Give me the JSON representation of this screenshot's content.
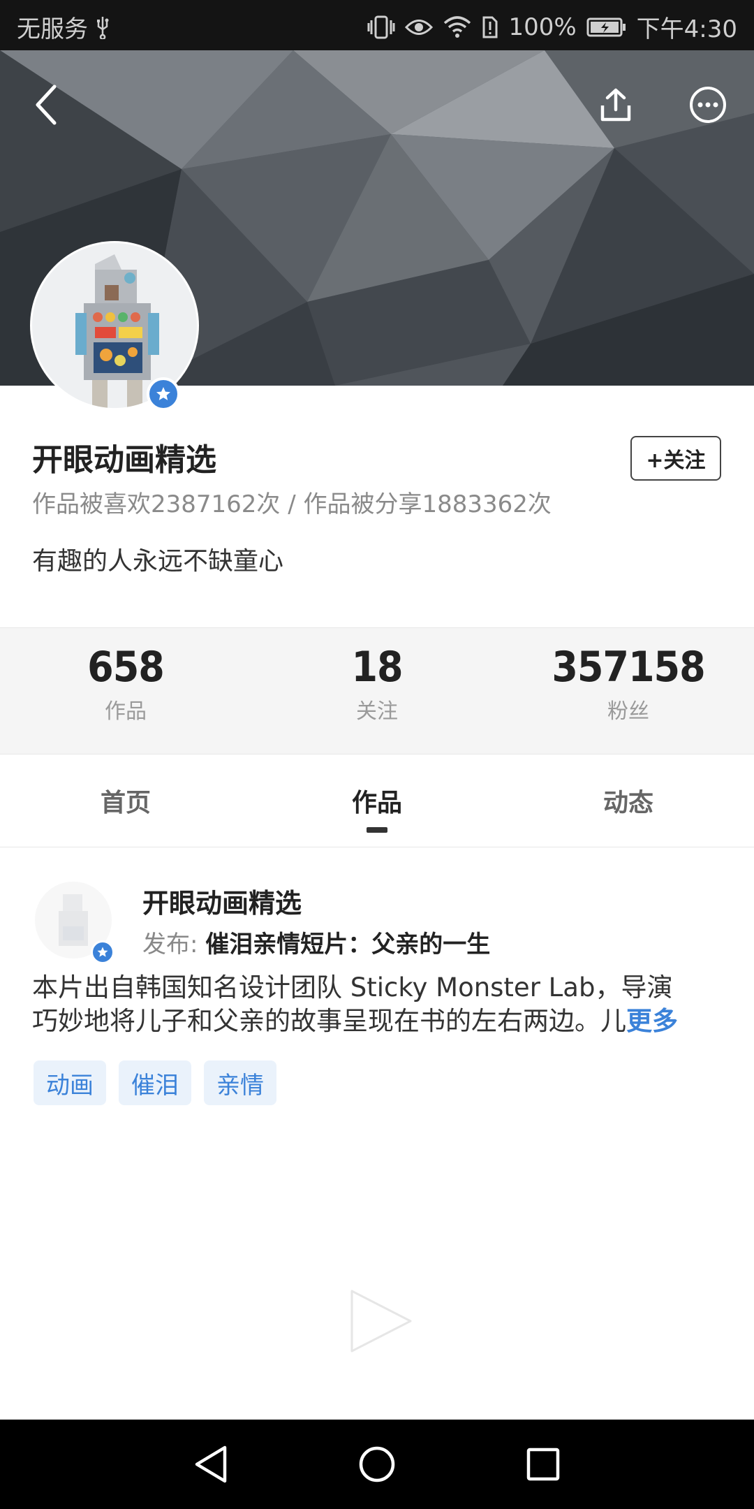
{
  "status_bar": {
    "carrier": "无服务",
    "battery": "100%",
    "time": "下午4:30"
  },
  "profile": {
    "name": "开眼动画精选",
    "follow_label": "+关注",
    "stats_line": "作品被喜欢2387162次 / 作品被分享1883362次",
    "bio": "有趣的人永远不缺童心"
  },
  "stats": [
    {
      "value": "658",
      "label": "作品"
    },
    {
      "value": "18",
      "label": "关注"
    },
    {
      "value": "357158",
      "label": "粉丝"
    }
  ],
  "tabs": [
    {
      "label": "首页",
      "active": false
    },
    {
      "label": "作品",
      "active": true
    },
    {
      "label": "动态",
      "active": false
    }
  ],
  "feed_item": {
    "author": "开眼动画精选",
    "publish_prefix": "发布:",
    "title": "催泪亲情短片：父亲的一生",
    "desc_line1": "本片出自韩国知名设计团队 Sticky Monster Lab，导演",
    "desc_line2": "巧妙地将儿子和父亲的故事呈现在书的左右两边。儿",
    "more_label": "更多",
    "tags": [
      "动画",
      "催泪",
      "亲情"
    ]
  },
  "colors": {
    "accent": "#3b82d9",
    "tag_bg": "#eaf2fb",
    "status_bar_bg": "#141414"
  }
}
